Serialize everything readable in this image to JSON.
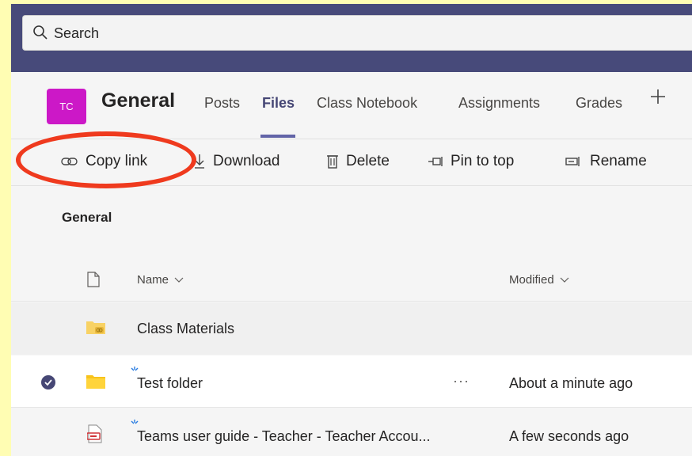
{
  "search": {
    "placeholder": "Search"
  },
  "channel": {
    "avatar_initials": "TC",
    "avatar_color": "#cc18c7",
    "title": "General",
    "tabs": [
      {
        "label": "Posts",
        "active": false
      },
      {
        "label": "Files",
        "active": true
      },
      {
        "label": "Class Notebook",
        "active": false
      },
      {
        "label": "Assignments",
        "active": false
      },
      {
        "label": "Grades",
        "active": false
      }
    ],
    "add_tab_icon": "plus-icon"
  },
  "commands": [
    {
      "label": "Copy link",
      "icon": "link-icon"
    },
    {
      "label": "Download",
      "icon": "download-icon"
    },
    {
      "label": "Delete",
      "icon": "trash-icon"
    },
    {
      "label": "Pin to top",
      "icon": "pin-icon"
    },
    {
      "label": "Rename",
      "icon": "rename-icon"
    }
  ],
  "folder_title": "General",
  "list": {
    "headers": {
      "name": "Name",
      "modified": "Modified"
    },
    "rows": [
      {
        "name": "Class Materials",
        "type": "folder-link",
        "modified": "",
        "selected": false
      },
      {
        "name": "Test folder",
        "type": "folder",
        "modified": "About a minute ago",
        "selected": true,
        "more": "···"
      },
      {
        "name": "Teams user guide - Teacher - Teacher Accou...",
        "type": "pdf",
        "modified": "A few seconds ago",
        "selected": false
      }
    ]
  },
  "colors": {
    "accent": "#6264a7",
    "topbar": "#474a7a",
    "annotation": "#ef3a1e",
    "background": "#fffdb3"
  }
}
